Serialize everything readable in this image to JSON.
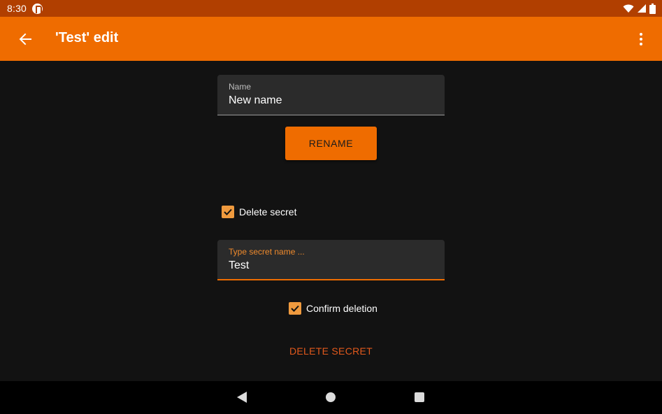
{
  "status_bar": {
    "time": "8:30",
    "icons": [
      "app-notification-icon",
      "wifi-icon",
      "signal-icon",
      "battery-icon"
    ]
  },
  "app_bar": {
    "title": "'Test' edit",
    "back_icon": "arrow-back-icon",
    "menu_icon": "more-vert-icon",
    "color": "#ef6c00"
  },
  "rename": {
    "label": "Name",
    "value": "New name",
    "button": "RENAME"
  },
  "delete": {
    "checkbox_label": "Delete secret",
    "checkbox_checked": true,
    "field_label": "Type secret name ...",
    "field_value": "Test",
    "confirm_label": "Confirm deletion",
    "confirm_checked": true,
    "button": "DELETE SECRET"
  },
  "nav_bar": {
    "icons": [
      "nav-back-icon",
      "nav-home-icon",
      "nav-recents-icon"
    ]
  },
  "colors": {
    "status_bar": "#b13f00",
    "accent": "#ef6c00",
    "background": "#121212",
    "field_bg": "#2b2b2b",
    "checkbox": "#ef9a3e",
    "danger_text": "#e2591c"
  }
}
